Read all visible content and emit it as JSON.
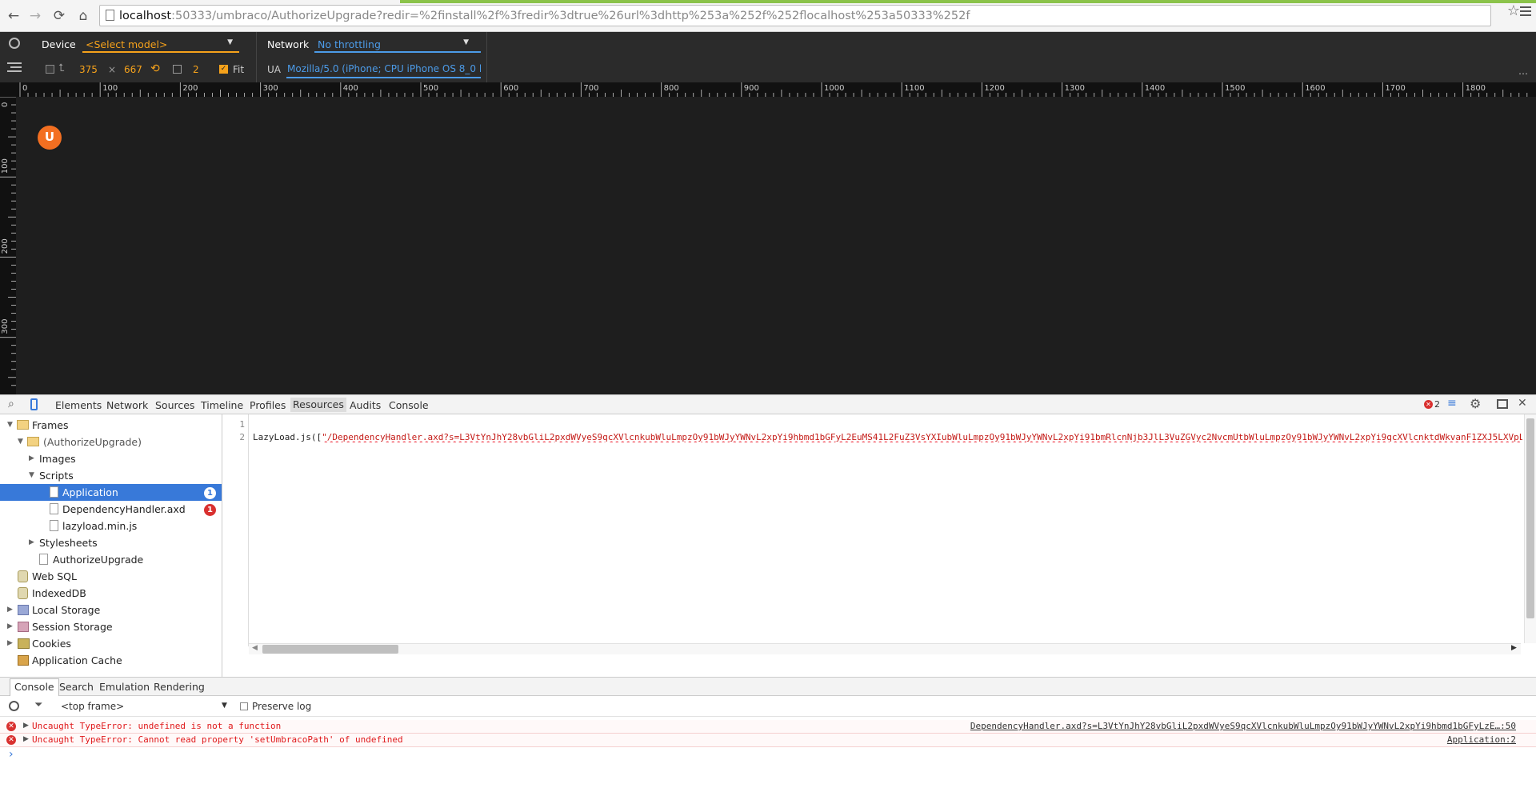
{
  "browser": {
    "url_host": "localhost",
    "url_rest": ":50333/umbraco/AuthorizeUpgrade?redir=%2finstall%2f%3fredir%3dtrue%26url%3dhttp%253a%252f%252flocalhost%253a50333%252f"
  },
  "device_toolbar": {
    "device_label": "Device",
    "device_select": "<Select model>",
    "network_label": "Network",
    "network_select": "No throttling",
    "width": "375",
    "times": "×",
    "height": "667",
    "dpr": "2",
    "fit_label": "Fit",
    "fit_checked": true,
    "ua_label": "UA",
    "ua_value": "Mozilla/5.0 (iPhone; CPU iPhone OS 8_0 li"
  },
  "ruler": {
    "h_ticks": [
      "0",
      "100",
      "200",
      "300",
      "400",
      "500",
      "600",
      "700",
      "800",
      "900",
      "1000",
      "1100",
      "1200",
      "1300",
      "1400",
      "1500",
      "1600",
      "1700",
      "1800"
    ],
    "v_ticks": [
      "0",
      "100",
      "200",
      "300"
    ]
  },
  "emulated_page": {
    "logo_letter": "U"
  },
  "devtools_tabs": [
    "Elements",
    "Network",
    "Sources",
    "Timeline",
    "Profiles",
    "Resources",
    "Audits",
    "Console"
  ],
  "active_tab": "Resources",
  "error_count": "2",
  "sidebar": {
    "frames": "Frames",
    "frame_name": "(AuthorizeUpgrade)",
    "images": "Images",
    "scripts": "Scripts",
    "script_items": [
      {
        "label": "Application",
        "badge": "1"
      },
      {
        "label": "DependencyHandler.axd",
        "badge": "1"
      },
      {
        "label": "lazyload.min.js",
        "badge": ""
      }
    ],
    "stylesheets": "Stylesheets",
    "doc": "AuthorizeUpgrade",
    "websql": "Web SQL",
    "indexeddb": "IndexedDB",
    "local_storage": "Local Storage",
    "session_storage": "Session Storage",
    "cookies": "Cookies",
    "app_cache": "Application Cache"
  },
  "code": {
    "line_numbers": [
      "1",
      "2"
    ],
    "line2_prefix": "LazyLoad.js([",
    "line2_string": "\"/DependencyHandler.axd?s=L3VtYnJhY28vbGliL2pxdWVyeS9qcXVlcnkubWluLmpzOy91bWJyYWNvL2xpYi9hbmd1bGFyL2EuMS41L2FuZ3VsYXIubWluLmpzOy91bWJyYWNvL2xpYi91bmRlcnNjb3JlL3VuZGVyc2NvcmUtbWluLmpzOy91bWJyYWNvL2xpYi9qcXVlcnktdWkvanF1ZXJ5LXVpLm1pbi5qcy"
  },
  "drawer_tabs": [
    "Console",
    "Search",
    "Emulation",
    "Rendering"
  ],
  "console": {
    "frame_select": "<top frame>",
    "preserve_log": "Preserve log",
    "errors": [
      {
        "msg": "Uncaught TypeError: undefined is not a function",
        "src": "DependencyHandler.axd?s=L3VtYnJhY28vbGliL2pxdWVyeS9qcXVlcnkubWluLmpzOy91bWJyYWNvL2xpYi9hbmd1bGFyLzE…:50"
      },
      {
        "msg": "Uncaught TypeError: Cannot read property 'setUmbracoPath' of undefined",
        "src": "Application:2"
      }
    ],
    "prompt": "›"
  }
}
